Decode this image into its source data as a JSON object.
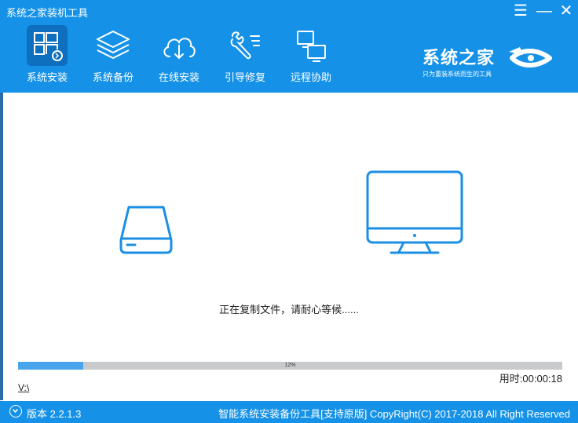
{
  "window": {
    "title": "系统之家装机工具",
    "controls": {
      "menu": "☰",
      "minimize": "—",
      "close": "✕"
    }
  },
  "nav": {
    "items": [
      {
        "label": "系统安装",
        "icon": "windows-install-icon",
        "active": true
      },
      {
        "label": "系统备份",
        "icon": "layers-backup-icon",
        "active": false
      },
      {
        "label": "在线安装",
        "icon": "cloud-download-icon",
        "active": false
      },
      {
        "label": "引导修复",
        "icon": "tools-repair-icon",
        "active": false
      },
      {
        "label": "远程协助",
        "icon": "remote-assist-icon",
        "active": false
      }
    ]
  },
  "brand": {
    "name": "系统之家",
    "slogan": "只为重装系统而生的工具"
  },
  "main": {
    "status": "正在复制文件，请耐心等候......",
    "progress": {
      "percent": 12,
      "label": "12%"
    },
    "elapsed": "用时:00:00:18",
    "path": "V:\\"
  },
  "footer": {
    "version": "版本 2.2.1.3",
    "copyright": "智能系统安装备份工具[支持原版]  CopyRight(C) 2017-2018 All Right Reserved"
  },
  "colors": {
    "header": "#1592e8",
    "accent": "#1b8fe6",
    "progress_fill": "#49a6ec",
    "progress_track": "#c9cacb"
  }
}
